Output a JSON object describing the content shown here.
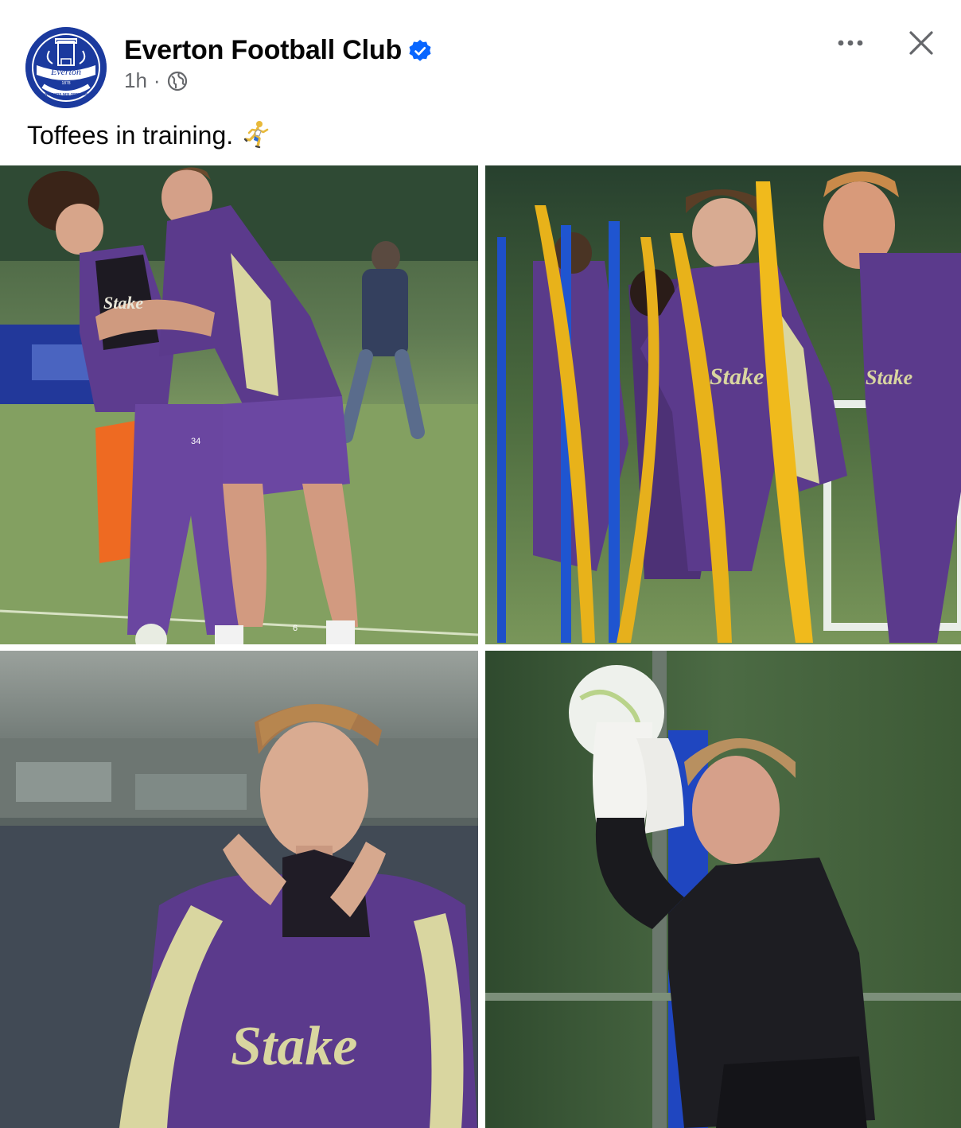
{
  "post": {
    "page_name": "Everton Football Club",
    "verified": true,
    "time": "1h",
    "separator": "·",
    "audience_icon": "globe-icon",
    "caption": "Toffees in training.",
    "caption_emoji_icon": "runner-icon",
    "more_icon": "more-horizontal-icon",
    "close_icon": "close-icon"
  },
  "avatar": {
    "crest_name": "Everton",
    "crest_year": "1878",
    "crest_motto": "NIL SATIS NISI OPTIMUM"
  },
  "photos": [
    {
      "name": "players-hugging-photo",
      "sponsor": "Stake",
      "shorts_numbers": [
        "34",
        "6"
      ]
    },
    {
      "name": "players-running-poles-photo",
      "sponsor": "Stake"
    },
    {
      "name": "player-adjusting-collar-photo",
      "sponsor": "Stake"
    },
    {
      "name": "goalkeeper-catching-ball-photo"
    }
  ],
  "colors": {
    "everton_blue": "#1b3a9e",
    "verified_blue": "#0866ff",
    "kit_purple": "#5b3a8c",
    "kit_accent": "#d9d6a0",
    "secondary_text": "#65676b"
  }
}
